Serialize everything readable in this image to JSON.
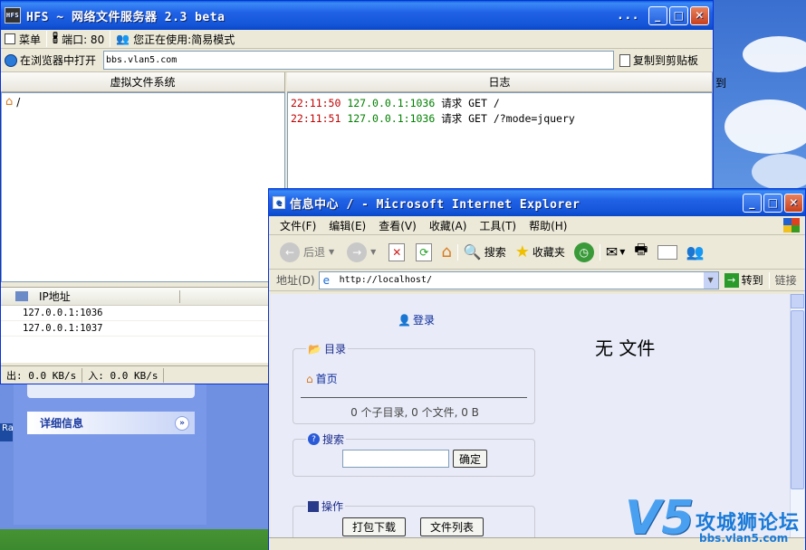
{
  "hfs": {
    "title": "HFS ~ 网络文件服务器 2.3 beta",
    "title_extra": "...",
    "menu_label": "菜单",
    "port_label": "端口: 80",
    "mode_label": "您正在使用:简易模式",
    "open_browser_label": "在浏览器中打开",
    "url_value": "bbs.vlan5.com",
    "copy_label": "复制到剪贴板",
    "vfs_header": "虚拟文件系统",
    "log_header": "日志",
    "vfs_root": "/",
    "log": [
      {
        "time": "22:11:50",
        "addr": "127.0.0.1:1036",
        "msg": "请求 GET /"
      },
      {
        "time": "22:11:51",
        "addr": "127.0.0.1:1036",
        "msg": "请求 GET /?mode=jquery"
      }
    ],
    "ip_header": "IP地址",
    "ips": [
      "127.0.0.1:1036",
      "127.0.0.1:1037"
    ],
    "status_out": "出: 0.0 KB/s",
    "status_in": "入: 0.0 KB/s",
    "right_fragment": "到"
  },
  "back_panel": {
    "details_label": "详细信息"
  },
  "ie": {
    "title": "信息中心 / - Microsoft Internet Explorer",
    "menu": [
      "文件(F)",
      "编辑(E)",
      "查看(V)",
      "收藏(A)",
      "工具(T)",
      "帮助(H)"
    ],
    "toolbar": {
      "back": "后退",
      "search": "搜索",
      "favorites": "收藏夹"
    },
    "address_label": "地址(D)",
    "address_value": "http://localhost/",
    "go_label": "转到",
    "links_label": "链接",
    "page": {
      "login": "登录",
      "dir_legend": "目录",
      "home_link": "首页",
      "dir_summary": "0 个子目录, 0 个文件, 0 B",
      "no_files": "无 文件",
      "search_legend": "搜索",
      "search_button": "确定",
      "actions_legend": "操作",
      "download_button": "打包下载",
      "list_button": "文件列表"
    }
  },
  "watermark": {
    "brand": "攻城狮论坛",
    "url": "bbs.vlan5.com"
  },
  "colors": {
    "xp_title": "#1556d9",
    "log_time": "#c00000",
    "log_addr": "#008000",
    "ie_page_bg": "#e9ecf8"
  }
}
